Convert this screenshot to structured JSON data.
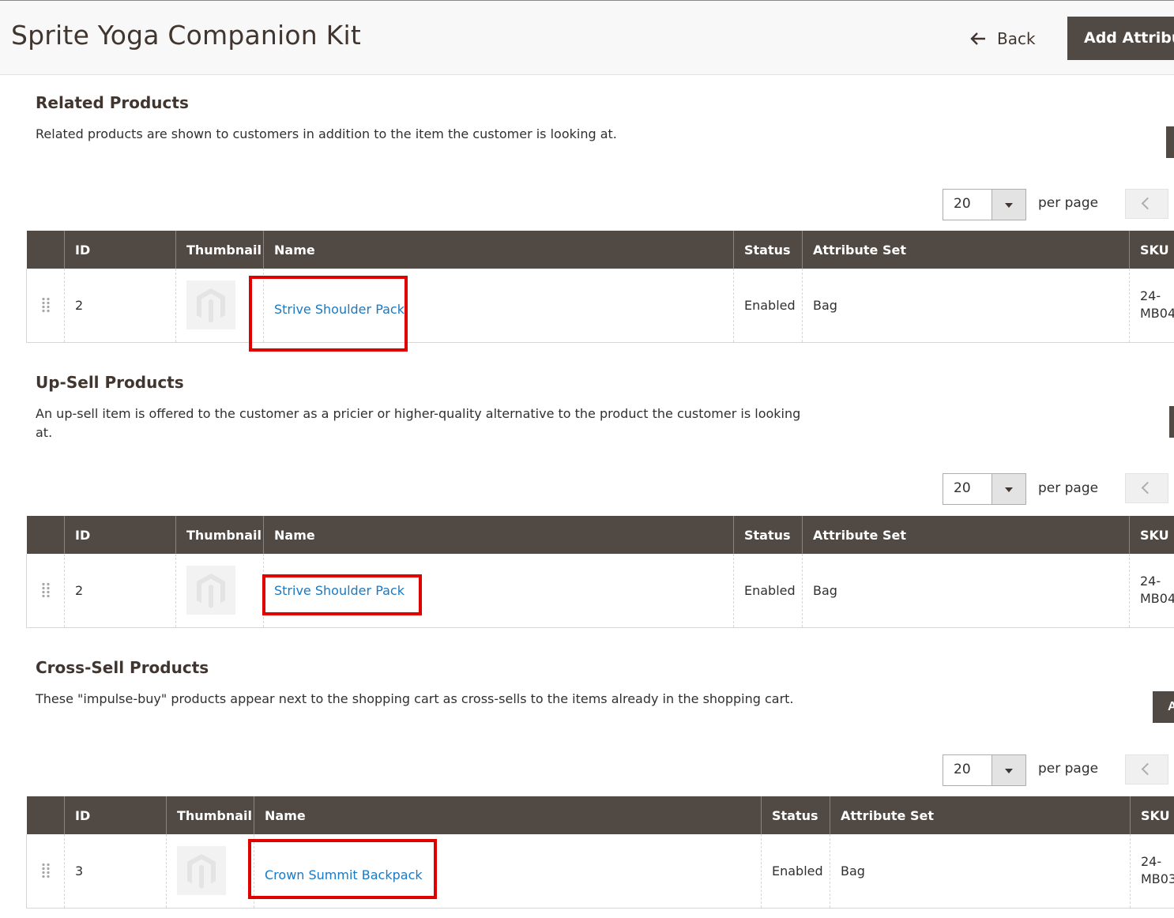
{
  "header": {
    "title": "Sprite Yoga Companion Kit",
    "back_label": "Back",
    "add_attribute_label": "Add Attribu"
  },
  "columns_a": [
    "ID",
    "Thumbnail",
    "Name",
    "Status",
    "Attribute Set",
    "SKU"
  ],
  "pager": {
    "per_page_value": "20",
    "per_page_label": "per page"
  },
  "sections": [
    {
      "title": "Related Products",
      "description": "Related products are shown to customers in addition to the item the customer is looking at.",
      "rows": [
        {
          "id": "2",
          "name": "Strive Shoulder Pack",
          "status": "Enabled",
          "attribute_set": "Bag",
          "sku": "24-MB04"
        }
      ]
    },
    {
      "title": "Up-Sell Products",
      "description": "An up-sell item is offered to the customer as a pricier or higher-quality alternative to the product the customer is looking at.",
      "rows": [
        {
          "id": "2",
          "name": "Strive Shoulder Pack",
          "status": "Enabled",
          "attribute_set": "Bag",
          "sku": "24-MB04"
        }
      ]
    },
    {
      "title": "Cross-Sell Products",
      "description": "These \"impulse-buy\" products appear next to the shopping cart as cross-sells to the items already in the shopping cart.",
      "button_label": "A",
      "rows": [
        {
          "id": "3",
          "name": "Crown Summit Backpack",
          "status": "Enabled",
          "attribute_set": "Bag",
          "sku": "24-MB03"
        }
      ]
    }
  ],
  "colors": {
    "header_bg": "#514943",
    "link": "#1979c3",
    "highlight": "#e00000"
  },
  "icons": {
    "back": "arrow-left-icon",
    "drag": "drag-handle-icon",
    "thumbnail": "magento-logo-icon",
    "pager_prev": "chevron-left-icon",
    "select": "caret-down-icon"
  }
}
